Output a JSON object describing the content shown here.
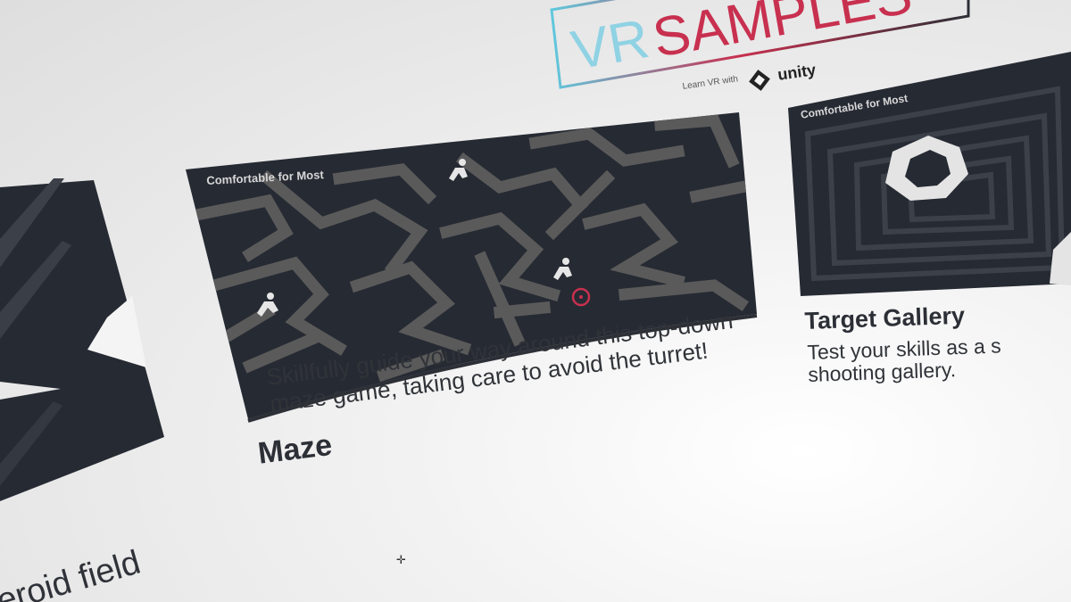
{
  "logo": {
    "vr": "VR",
    "samples": "SAMPLES",
    "subtitle": "Learn VR with",
    "brand": "unity"
  },
  "cards": [
    {
      "id": "asteroid",
      "caption": "eroid field"
    },
    {
      "id": "maze",
      "badge": "Comfortable for Most",
      "title": "Maze",
      "description_lines": [
        "Skillfully guide your way around this top-down",
        "maze game, taking care to avoid the turret!"
      ]
    },
    {
      "id": "target-gallery",
      "badge": "Comfortable for Most",
      "title": "Target Gallery",
      "description_lines": [
        "Test your skills as a s",
        "shooting gallery."
      ]
    }
  ],
  "colors": {
    "background": "#ececec",
    "card_dark": "#262a33",
    "maze_wall": "#5a5a5a",
    "text_dark": "#2c2f36",
    "accent_red": "#c8304f",
    "accent_cyan": "#5fc8de"
  },
  "icons": [
    "unity-logo-icon",
    "runner-icon",
    "turret-target-icon",
    "gaze-cursor-icon"
  ]
}
